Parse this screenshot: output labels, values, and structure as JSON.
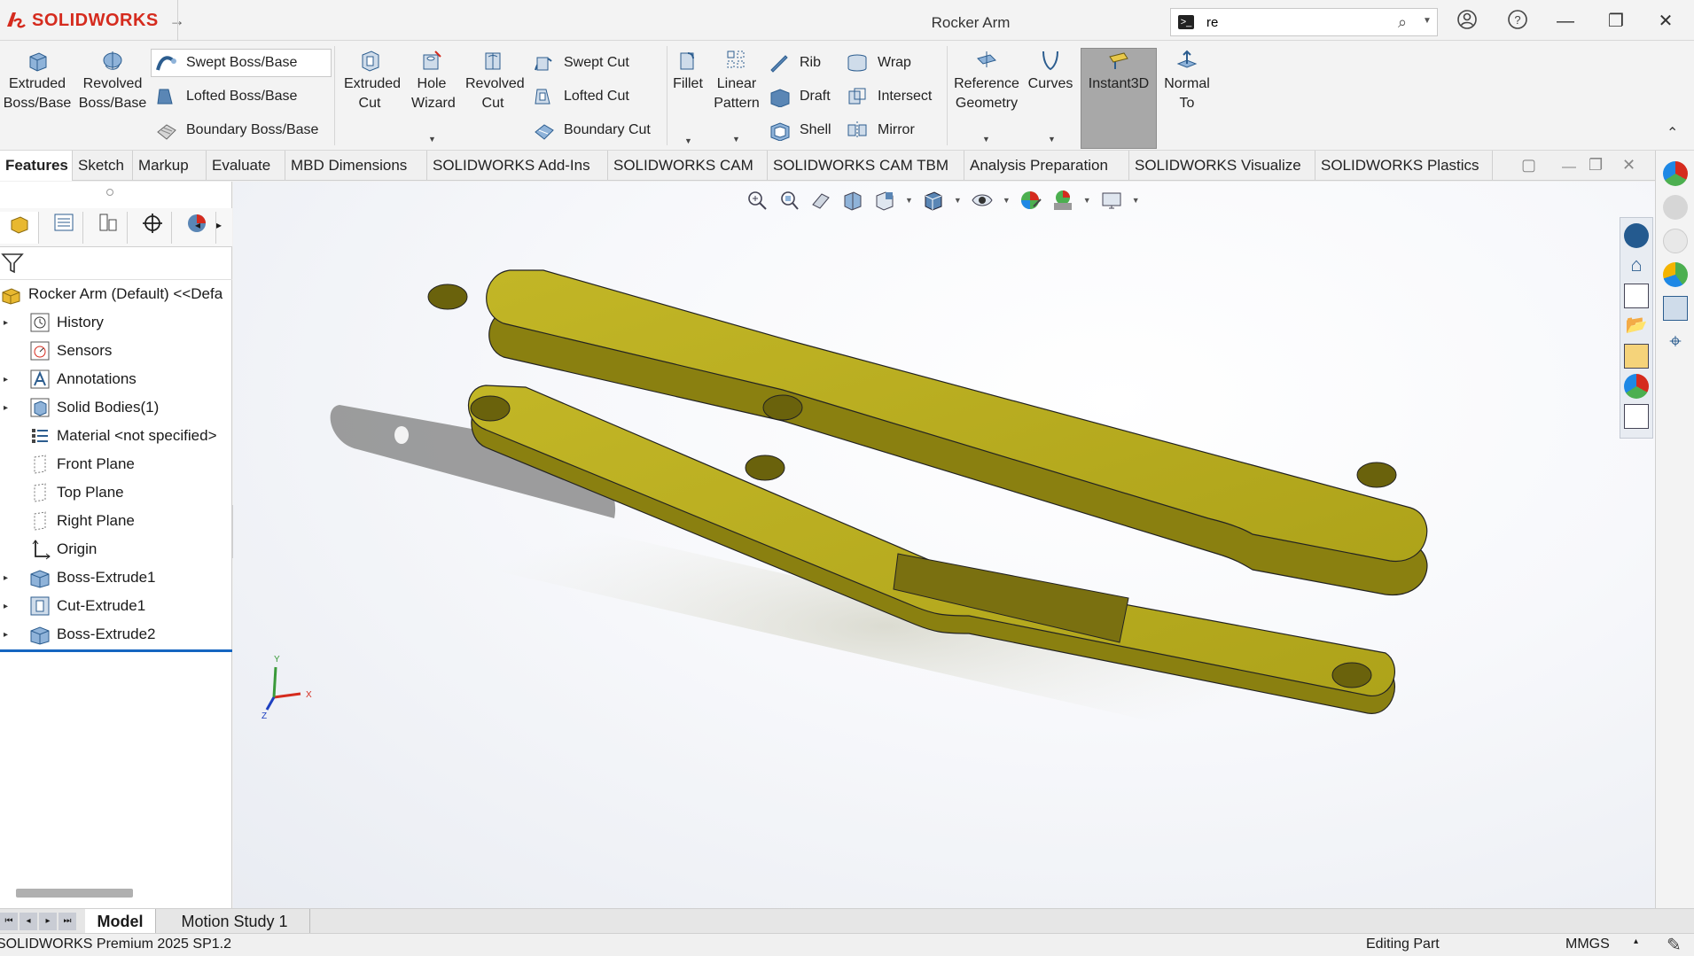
{
  "app": {
    "brand": "SOLIDWORKS",
    "document_title": "Rocker Arm"
  },
  "search": {
    "value": "re"
  },
  "ribbon": {
    "extruded_boss_base": "Extruded Boss/Base",
    "revolved_boss_base": "Revolved Boss/Base",
    "swept_boss_base": "Swept Boss/Base",
    "lofted_boss_base": "Lofted Boss/Base",
    "boundary_boss_base": "Boundary Boss/Base",
    "extruded_cut": "Extruded Cut",
    "hole_wizard": "Hole Wizard",
    "revolved_cut": "Revolved Cut",
    "swept_cut": "Swept Cut",
    "lofted_cut": "Lofted Cut",
    "boundary_cut": "Boundary Cut",
    "fillet": "Fillet",
    "linear_pattern": "Linear Pattern",
    "rib": "Rib",
    "draft": "Draft",
    "shell": "Shell",
    "wrap": "Wrap",
    "intersect": "Intersect",
    "mirror": "Mirror",
    "reference_geometry": "Reference Geometry",
    "curves": "Curves",
    "instant3d": "Instant3D",
    "normal_to": "Normal To"
  },
  "tabs": [
    "Features",
    "Sketch",
    "Markup",
    "Evaluate",
    "MBD Dimensions",
    "SOLIDWORKS Add-Ins",
    "SOLIDWORKS CAM",
    "SOLIDWORKS CAM TBM",
    "Analysis Preparation",
    "SOLIDWORKS Visualize",
    "SOLIDWORKS Plastics"
  ],
  "tree": {
    "root": "Rocker Arm (Default) <<Defa",
    "items": [
      "History",
      "Sensors",
      "Annotations",
      "Solid Bodies(1)",
      "Material <not specified>",
      "Front Plane",
      "Top Plane",
      "Right Plane",
      "Origin",
      "Boss-Extrude1",
      "Cut-Extrude1",
      "Boss-Extrude2"
    ]
  },
  "triad": {
    "x": "X",
    "y": "Y",
    "z": "Z"
  },
  "bottom_tabs": [
    "Model",
    "Motion Study 1"
  ],
  "status": {
    "product": "SOLIDWORKS Premium 2025 SP1.2",
    "mode": "Editing Part",
    "units": "MMGS"
  },
  "colors": {
    "brand_red": "#d52b1e",
    "part_yellow": "#b5aa1e",
    "selection_blue": "#1565c0"
  }
}
